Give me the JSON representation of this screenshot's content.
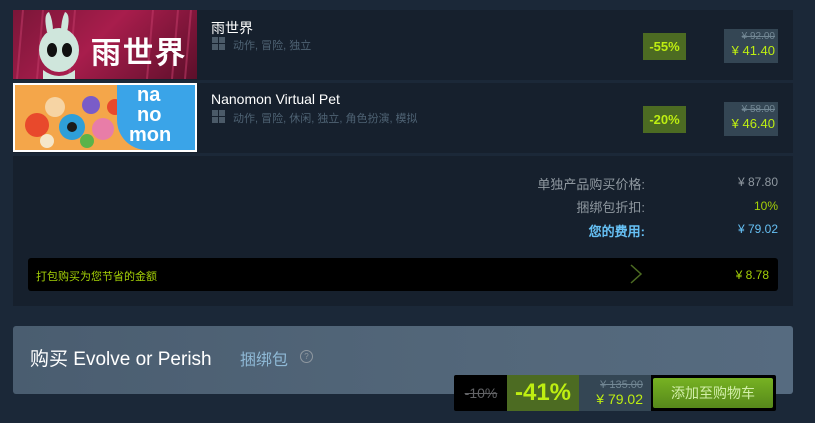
{
  "items": [
    {
      "name": "雨世界",
      "capsule_text": "雨世界",
      "tags": "动作, 冒险, 独立",
      "discount": "-55%",
      "original_price": "¥ 92.00",
      "final_price": "¥ 41.40",
      "platform_icon": "windows-icon"
    },
    {
      "name": "Nanomon Virtual Pet",
      "capsule_text": [
        "na",
        "no",
        "mon"
      ],
      "tags": "动作, 冒险, 休闲, 独立, 角色扮演, 模拟",
      "discount": "-20%",
      "original_price": "¥ 58.00",
      "final_price": "¥ 46.40",
      "platform_icon": "windows-icon"
    }
  ],
  "summary": {
    "individual_label": "单独产品购买价格:",
    "individual_value": "¥ 87.80",
    "bundle_discount_label": "捆绑包折扣:",
    "bundle_discount_value": "10%",
    "your_cost_label": "您的费用:",
    "your_cost_value": "¥ 79.02",
    "savings_label": "打包购买为您节省的金额",
    "savings_value": "¥ 8.78"
  },
  "buy": {
    "title": "购买 Evolve or Perish",
    "bundle_link": "捆绑包",
    "help": "?",
    "bundle_discount": "-10%",
    "discount": "-41%",
    "original_price": "¥ 135.00",
    "final_price": "¥ 79.02",
    "add_to_cart": "添加至购物车"
  },
  "colors": {
    "background": "#1b2838",
    "discount_bg": "#4c6b22",
    "discount_text": "#beee11",
    "button_green": "#75b022",
    "link_blue": "#66c0f4"
  }
}
